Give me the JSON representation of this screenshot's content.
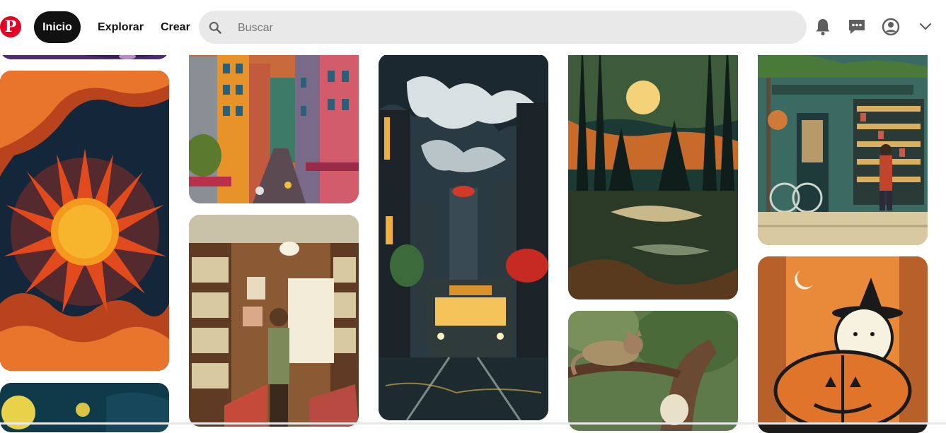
{
  "header": {
    "logo_letter": "P",
    "nav": {
      "home": "Inicio",
      "explore": "Explorar",
      "create": "Crear"
    },
    "search_placeholder": "Buscar"
  },
  "icons": {
    "logo": "pinterest-logo-icon",
    "search": "search-icon",
    "notifications": "bell-icon",
    "messages": "message-icon",
    "profile": "profile-icon",
    "account_menu": "chevron-down-icon"
  },
  "pins": [
    {
      "name": "purple-pattern-pin"
    },
    {
      "name": "sun-illustration-pin"
    },
    {
      "name": "moon-night-pin"
    },
    {
      "name": "colorful-town-street-pin"
    },
    {
      "name": "record-store-pin"
    },
    {
      "name": "city-tram-night-pin"
    },
    {
      "name": "forest-moon-lake-pin"
    },
    {
      "name": "cheshire-cat-tree-pin"
    },
    {
      "name": "shop-storefront-pin"
    },
    {
      "name": "halloween-pumpkin-ghost-pin"
    }
  ],
  "colors": {
    "brand": "#e60023",
    "active_nav_bg": "#111111",
    "search_bg": "#e9e9e9"
  }
}
